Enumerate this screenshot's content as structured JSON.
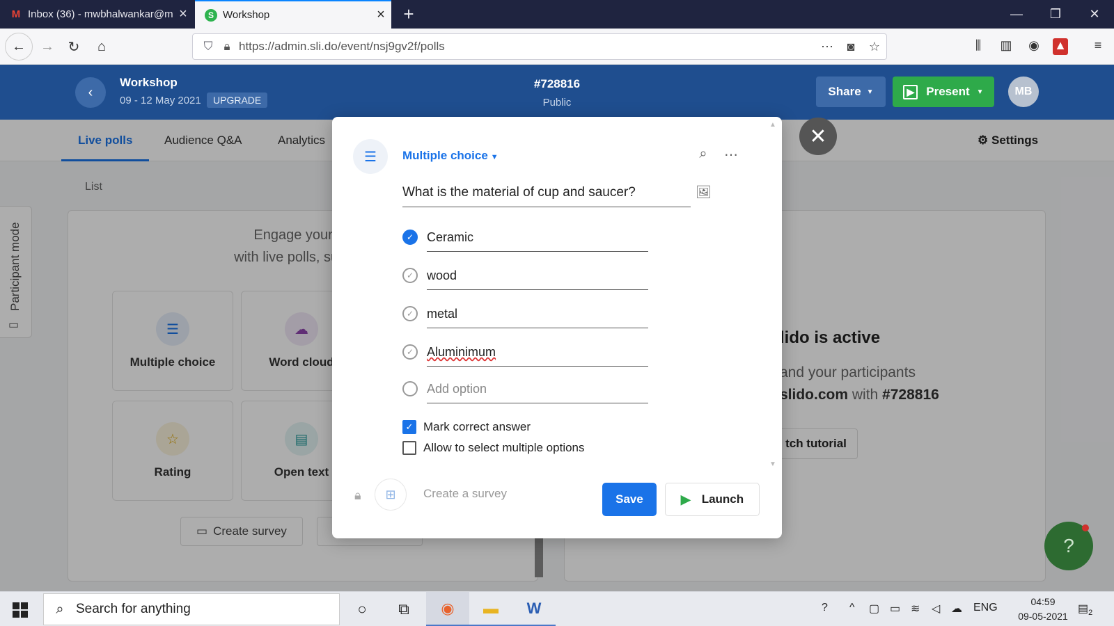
{
  "browser": {
    "tabs": [
      {
        "label": "Inbox (36) - mwbhalwankar@m",
        "icon": "gmail-icon"
      },
      {
        "label": "Workshop",
        "icon": "slido-icon"
      }
    ],
    "url": "https://admin.sli.do/event/nsj9gv2f/polls"
  },
  "header": {
    "event_title": "Workshop",
    "event_dates": "09 - 12 May 2021",
    "upgrade_label": "UPGRADE",
    "event_code": "#728816",
    "visibility": "Public",
    "share_label": "Share",
    "present_label": "Present",
    "avatar_initials": "MB"
  },
  "subnav": {
    "tabs": [
      "Live polls",
      "Audience Q&A",
      "Analytics"
    ],
    "settings_label": "Settings",
    "list_label": "List"
  },
  "background": {
    "engage_line1": "Engage your au",
    "engage_line2": "with live polls, surveys",
    "tiles": [
      "Multiple choice",
      "Word cloud",
      "Rating",
      "Open text"
    ],
    "create_survey_label": "Create survey",
    "active_title": "lido is active",
    "active_line1": "and your participants",
    "active_line2_prefix": "slido.com",
    "active_line2_mid": " with ",
    "active_line2_code": "#728816",
    "tutorial_label": "tch tutorial",
    "participant_mode_label": "Participant mode"
  },
  "modal": {
    "poll_type": "Multiple choice",
    "question": "What is the material of cup and saucer?",
    "options": [
      {
        "text": "Ceramic",
        "correct": true
      },
      {
        "text": "wood",
        "correct": false
      },
      {
        "text": "metal",
        "correct": false
      },
      {
        "text": "Aluminimum",
        "correct": false
      }
    ],
    "add_option_placeholder": "Add option",
    "mark_correct_label": "Mark correct answer",
    "mark_correct_checked": true,
    "allow_multiple_label": "Allow to select multiple options",
    "allow_multiple_checked": false,
    "create_survey_label": "Create a survey",
    "save_label": "Save",
    "launch_label": "Launch"
  },
  "taskbar": {
    "search_placeholder": "Search for anything",
    "language": "ENG",
    "time": "04:59",
    "date": "09-05-2021",
    "notification_count": "2"
  },
  "colors": {
    "brand_header": "#1f4e8f",
    "accent_blue": "#1a73e8",
    "present_green": "#2eaa4a"
  }
}
